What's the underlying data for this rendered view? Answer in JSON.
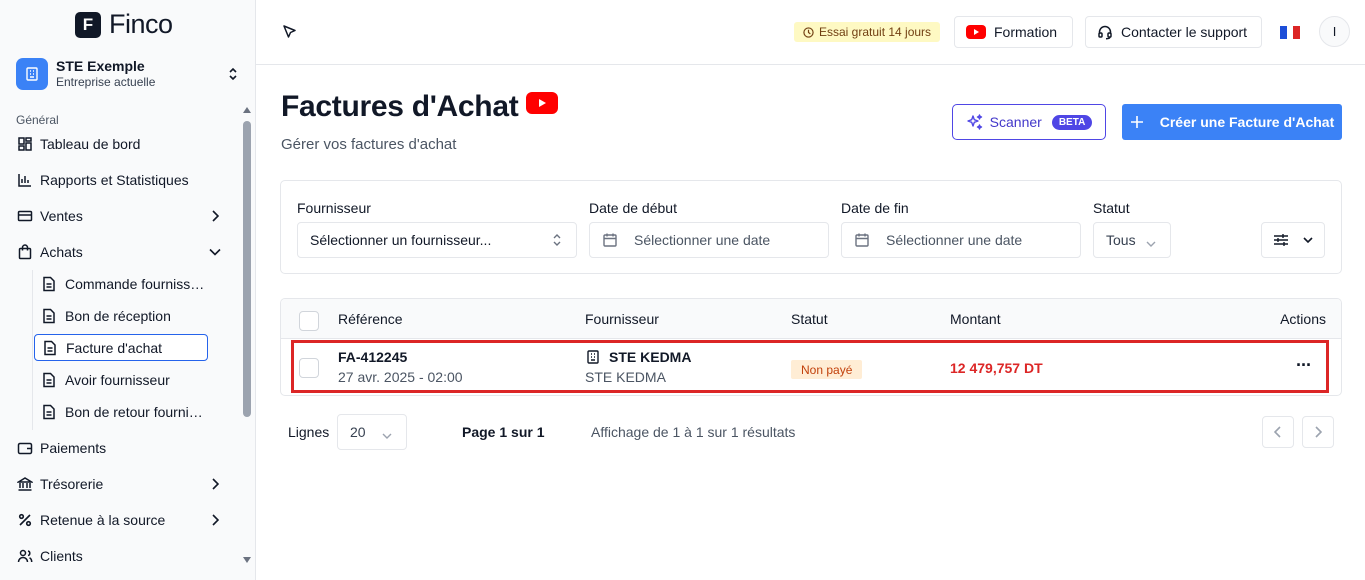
{
  "app": {
    "logo_letter": "F",
    "logo_name": "Finco"
  },
  "company": {
    "name": "STE Exemple",
    "subtitle": "Entreprise actuelle"
  },
  "sidebar": {
    "section_general": "Général",
    "items": [
      {
        "label": "Tableau de bord"
      },
      {
        "label": "Rapports et Statistiques"
      },
      {
        "label": "Ventes"
      },
      {
        "label": "Achats"
      },
      {
        "label": "Paiements"
      },
      {
        "label": "Trésorerie"
      },
      {
        "label": "Retenue à la source"
      },
      {
        "label": "Clients"
      }
    ],
    "achats_sub": [
      {
        "label": "Commande fournisseur"
      },
      {
        "label": "Bon de réception"
      },
      {
        "label": "Facture d'achat"
      },
      {
        "label": "Avoir fournisseur"
      },
      {
        "label": "Bon de retour fournisseur"
      }
    ]
  },
  "header": {
    "trial": "Essai gratuit 14 jours",
    "formation": "Formation",
    "support": "Contacter le support",
    "avatar_initial": "I"
  },
  "page": {
    "title": "Factures d'Achat",
    "subtitle": "Gérer vos factures d'achat",
    "scanner_label": "Scanner",
    "beta_label": "BETA",
    "create_label": "Créer une Facture d'Achat"
  },
  "filters": {
    "supplier_label": "Fournisseur",
    "supplier_placeholder": "Sélectionner un fournisseur...",
    "start_label": "Date de début",
    "start_placeholder": "Sélectionner une date",
    "end_label": "Date de fin",
    "end_placeholder": "Sélectionner une date",
    "status_label": "Statut",
    "status_value": "Tous"
  },
  "table": {
    "columns": [
      "Référence",
      "Fournisseur",
      "Statut",
      "Montant",
      "Actions"
    ],
    "rows": [
      {
        "reference": "FA-412245",
        "date": "27 avr. 2025 - 02:00",
        "supplier": "STE KEDMA",
        "supplier_sub": "STE KEDMA",
        "status": "Non payé",
        "amount": "12 479,757 DT",
        "actions": "···"
      }
    ]
  },
  "pager": {
    "rows_label": "Lignes",
    "rows_value": "20",
    "page_info": "Page 1 sur 1",
    "results_info": "Affichage de 1 à 1 sur 1 résultats"
  },
  "colors": {
    "primary": "#3b82f6",
    "accent": "#4f46e5",
    "danger": "#dc2626",
    "badge_bg": "#ffedd5"
  }
}
